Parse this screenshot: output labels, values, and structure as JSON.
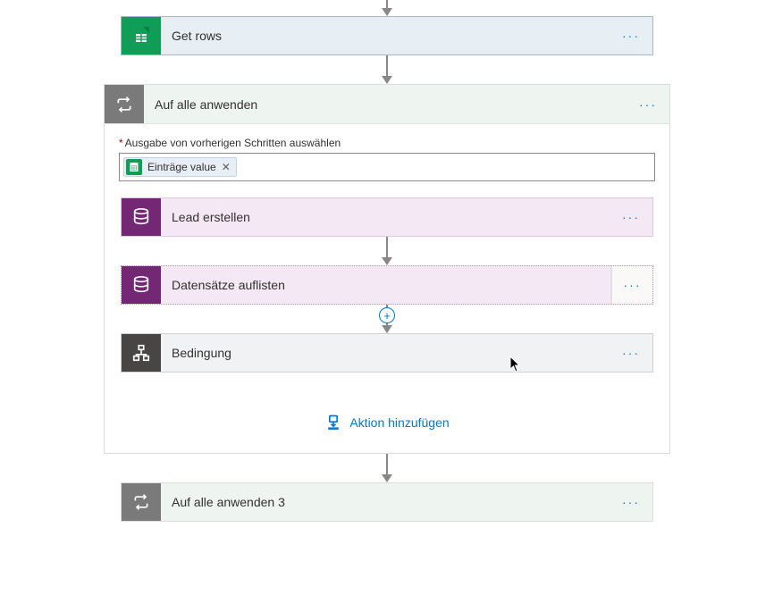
{
  "get_rows": {
    "title": "Get rows"
  },
  "foreach": {
    "title": "Auf alle anwenden",
    "field_label": "Ausgabe von vorherigen Schritten auswählen",
    "token": "Einträge value"
  },
  "lead": {
    "title": "Lead erstellen"
  },
  "list": {
    "title": "Datensätze auflisten"
  },
  "condition": {
    "title": "Bedingung"
  },
  "add_action_label": "Aktion hinzufügen",
  "foreach3": {
    "title": "Auf alle anwenden 3"
  }
}
